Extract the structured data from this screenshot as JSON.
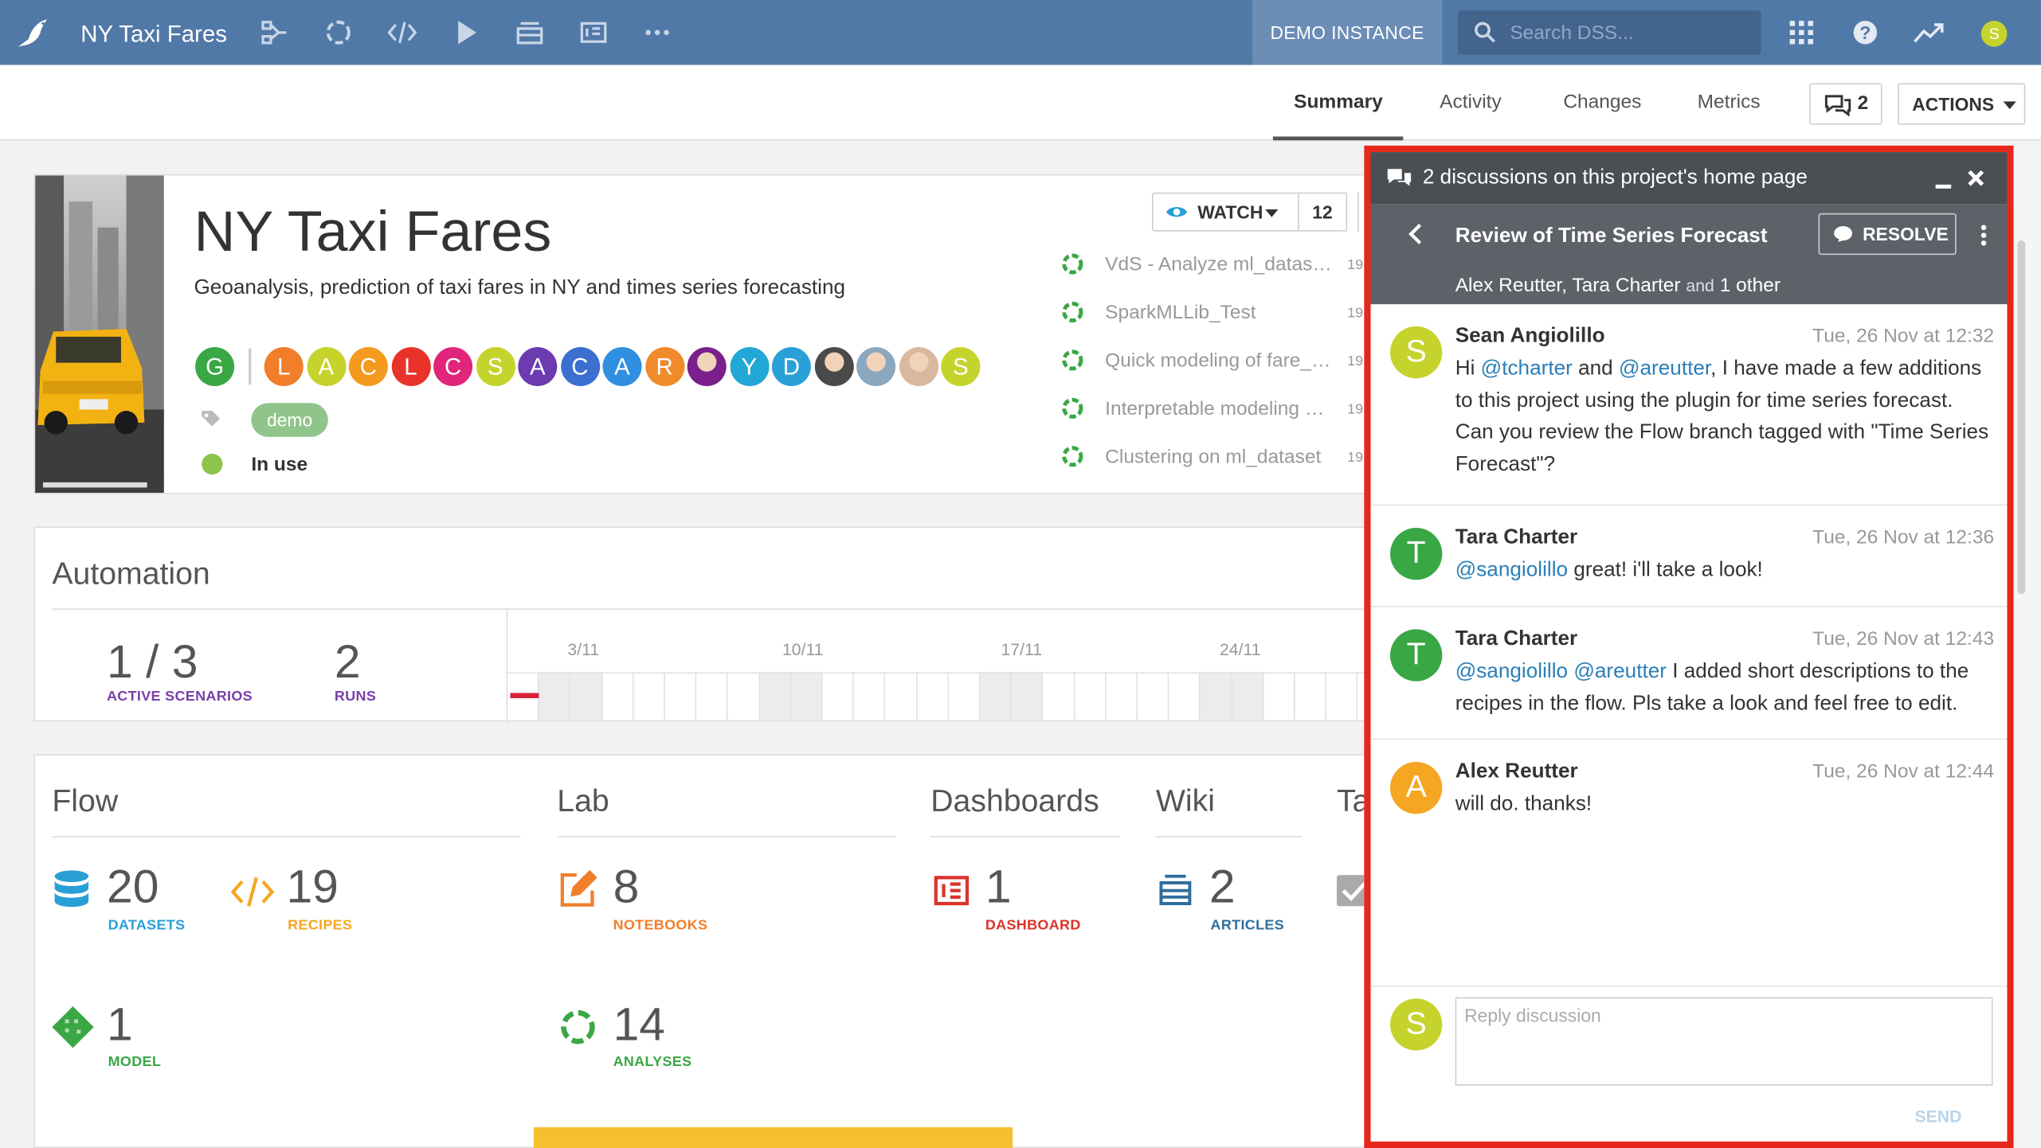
{
  "app": {
    "project_name": "NY Taxi Fares",
    "instance_label": "DEMO INSTANCE",
    "search_placeholder": "Search DSS...",
    "user_initial": "S"
  },
  "nav": {
    "icons": [
      "flow-icon",
      "analyses-icon",
      "code-icon",
      "run-icon",
      "wiki-icon",
      "dashboard-icon",
      "more-icon"
    ],
    "right_icons": [
      "apps-grid-icon",
      "help-icon",
      "activity-trend-icon"
    ]
  },
  "tabs": {
    "summary": "Summary",
    "activity": "Activity",
    "changes": "Changes",
    "metrics": "Metrics",
    "discussions_count": "2",
    "actions": "ACTIONS"
  },
  "project": {
    "title": "NY Taxi Fares",
    "description": "Geoanalysis, prediction of taxi fares in NY and times series forecasting",
    "group_avatar": "G",
    "contributors": [
      {
        "initial": "L",
        "color": "#f07e2b"
      },
      {
        "initial": "A",
        "color": "#c6d32c"
      },
      {
        "initial": "C",
        "color": "#f39a1f"
      },
      {
        "initial": "L",
        "color": "#e8332a"
      },
      {
        "initial": "C",
        "color": "#e0267a"
      },
      {
        "initial": "S",
        "color": "#c6d32c"
      },
      {
        "initial": "A",
        "color": "#6c3bb0"
      },
      {
        "initial": "C",
        "color": "#3b6fd0"
      },
      {
        "initial": "A",
        "color": "#2f8fe0"
      },
      {
        "initial": "R",
        "color": "#f08a2b"
      },
      {
        "initial": "",
        "color": "#7a1f8c"
      },
      {
        "initial": "Y",
        "color": "#22a7d6"
      },
      {
        "initial": "D",
        "color": "#2aa0d8"
      },
      {
        "initial": "",
        "color": "#4a4a4a"
      },
      {
        "initial": "",
        "color": "#8aa8c0"
      },
      {
        "initial": "",
        "color": "#d9b8a0"
      },
      {
        "initial": "S",
        "color": "#c6d32c"
      }
    ],
    "tag": "demo",
    "status": "In use",
    "watch_label": "WATCH",
    "watch_count": "12",
    "analyses": [
      {
        "name": "VdS - Analyze ml_datas…",
        "date": "19"
      },
      {
        "name": "SparkMLLib_Test",
        "date": "19"
      },
      {
        "name": "Quick modeling of fare_…",
        "date": "19"
      },
      {
        "name": "Interpretable modeling …",
        "date": "19"
      },
      {
        "name": "Clustering on ml_dataset",
        "date": "19"
      }
    ]
  },
  "automation": {
    "title": "Automation",
    "scenarios": "1 / 3",
    "scenarios_label": "ACTIVE SCENARIOS",
    "runs": "2",
    "runs_label": "RUNS",
    "timeline_dates": [
      "3/11",
      "10/11",
      "17/11",
      "24/11"
    ]
  },
  "flow": {
    "title": "Flow",
    "datasets": "20",
    "datasets_label": "DATASETS",
    "recipes": "19",
    "recipes_label": "RECIPES",
    "models": "1",
    "models_label": "MODEL"
  },
  "lab": {
    "title": "Lab",
    "notebooks": "8",
    "notebooks_label": "NOTEBOOKS",
    "analyses": "14",
    "analyses_label": "ANALYSES"
  },
  "dashboards": {
    "title": "Dashboards",
    "count": "1",
    "label": "DASHBOARD"
  },
  "wiki": {
    "title": "Wiki",
    "count": "2",
    "label": "ARTICLES"
  },
  "tasks": {
    "title": "Ta"
  },
  "discussion": {
    "header": "2 discussions on this project's home page",
    "topic": "Review of Time Series Forecast",
    "resolve_label": "RESOLVE",
    "participants": "Alex Reutter, Tara Charter",
    "participants_and": "and",
    "participants_more": "1 other",
    "messages": [
      {
        "author": "Sean Angiolillo",
        "initial": "S",
        "color": "#c6d32c",
        "date": "Tue, 26 Nov at 12:32",
        "parts": [
          "Hi ",
          "@tcharter",
          " and ",
          "@areutter",
          ", I have made a few additions to this project using the plugin for time series forecast. Can you review the Flow branch tagged with \"Time Series Forecast\"?"
        ]
      },
      {
        "author": "Tara Charter",
        "initial": "T",
        "color": "#3aa745",
        "date": "Tue, 26 Nov at 12:36",
        "parts": [
          "@sangiolillo",
          " great! i'll take a look!"
        ]
      },
      {
        "author": "Tara Charter",
        "initial": "T",
        "color": "#3aa745",
        "date": "Tue, 26 Nov at 12:43",
        "parts": [
          "@sangiolillo",
          " ",
          "@areutter",
          " I added short descriptions to the recipes in the flow. Pls take a look and feel free to edit."
        ]
      },
      {
        "author": "Alex Reutter",
        "initial": "A",
        "color": "#f5a623",
        "date": "Tue, 26 Nov at 12:44",
        "parts": [
          "will do. thanks!"
        ]
      }
    ],
    "reply_initial": "S",
    "reply_placeholder": "Reply discussion",
    "send_label": "SEND"
  },
  "colors": {
    "nav": "#5179a8",
    "panel_border": "#e8271c",
    "mention": "#2a7fb8",
    "scenarios": "#7b3fa8",
    "runs": "#7b3fa8",
    "datasets": "#2a9fd6",
    "recipes": "#f5a623",
    "model": "#3aa745",
    "notebooks": "#f07e2b",
    "analyses": "#3aa745",
    "dashboard": "#d9342b",
    "wiki": "#2f6e9c"
  }
}
